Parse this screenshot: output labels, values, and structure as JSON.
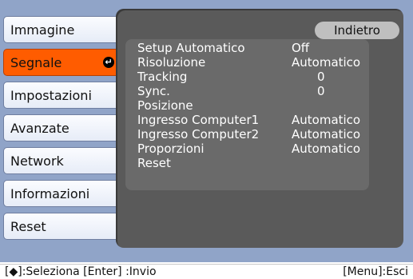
{
  "sidebar": {
    "items": [
      {
        "label": "Immagine"
      },
      {
        "label": "Segnale",
        "active": true,
        "icon": "enter-icon"
      },
      {
        "label": "Impostazioni"
      },
      {
        "label": "Avanzate"
      },
      {
        "label": "Network"
      },
      {
        "label": "Informazioni"
      },
      {
        "label": "Reset"
      }
    ]
  },
  "panel": {
    "back_label": "Indietro",
    "rows": [
      {
        "label": "Setup Automatico",
        "value": "Off"
      },
      {
        "label": "Risoluzione",
        "value": "Automatico"
      },
      {
        "label": "Tracking",
        "value": "0"
      },
      {
        "label": "Sync.",
        "value": "0"
      },
      {
        "label": "Posizione",
        "value": ""
      },
      {
        "label": "Ingresso Computer1",
        "value": "Automatico"
      },
      {
        "label": "Ingresso Computer2",
        "value": "Automatico"
      },
      {
        "label": "Proporzioni",
        "value": "Automatico"
      },
      {
        "label": "Reset",
        "value": ""
      }
    ]
  },
  "footer": {
    "left": "[◆]:Seleziona  [Enter] :Invio",
    "right": "[Menu]:Esci"
  },
  "colors": {
    "frame": "#90a4c8",
    "active_tab": "#ff5c00",
    "panel": "#5a5a5a",
    "items_area": "#6a6a6a"
  }
}
